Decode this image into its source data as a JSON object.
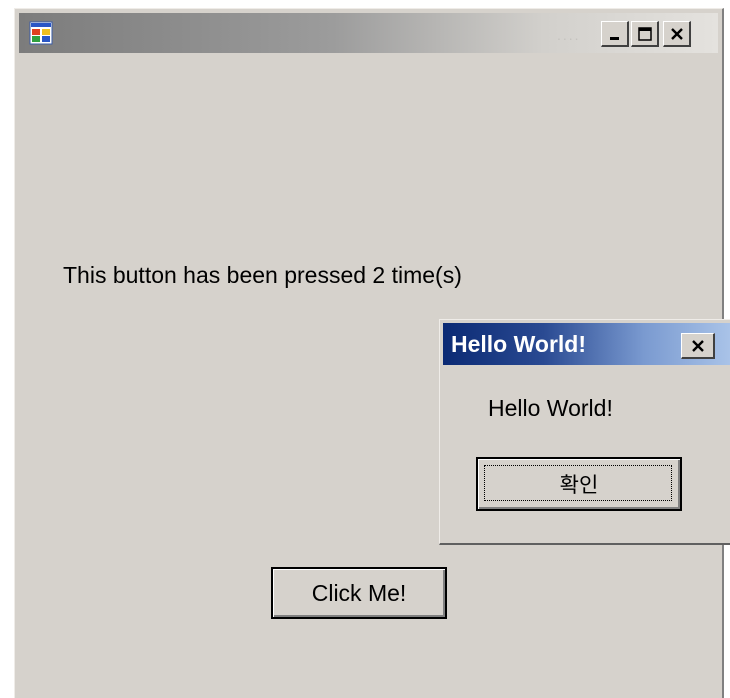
{
  "main_window": {
    "title_dots": "....",
    "icons": {
      "app": "app-window-icon",
      "minimize": "minimize-icon",
      "maximize": "maximize-icon",
      "close": "close-icon"
    },
    "press_message": "This button has been pressed 2 time(s)",
    "click_button_label": "Click Me!"
  },
  "dialog": {
    "title": "Hello World!",
    "message": "Hello World!",
    "ok_button_label": "확인",
    "icons": {
      "close": "close-icon"
    }
  },
  "colors": {
    "window_bg": "#d6d2cc",
    "dialog_title_start": "#0b2a74",
    "dialog_title_end": "#a9c3e8"
  }
}
